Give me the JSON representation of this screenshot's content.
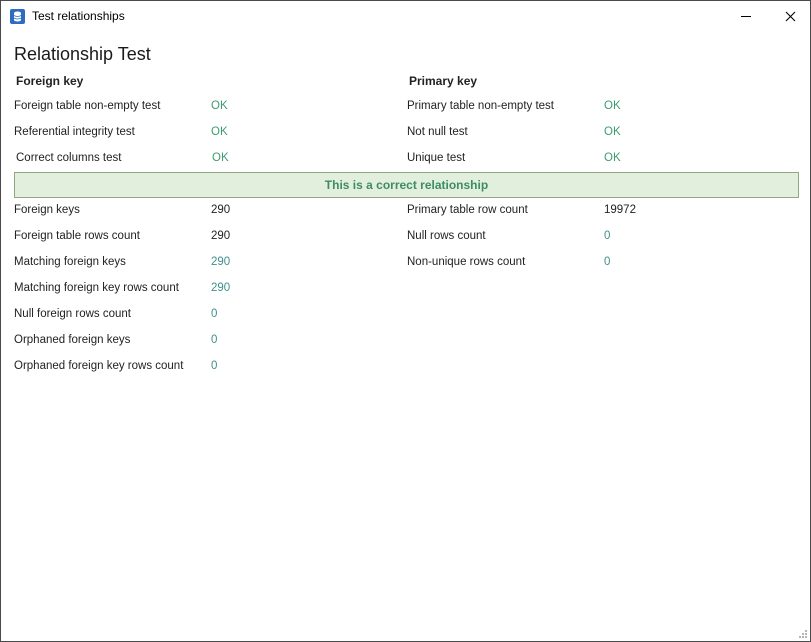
{
  "window": {
    "title": "Test relationships"
  },
  "heading": "Relationship Test",
  "foreign_key": {
    "title": "Foreign key",
    "tests": [
      {
        "label": "Foreign table non-empty test",
        "value": "OK"
      },
      {
        "label": "Referential integrity test",
        "value": "OK"
      },
      {
        "label": "Correct columns test",
        "value": "OK"
      }
    ],
    "stats": [
      {
        "label": "Foreign keys",
        "value": "290"
      },
      {
        "label": "Foreign table rows count",
        "value": "290"
      },
      {
        "label": "Matching foreign keys",
        "value": "290"
      },
      {
        "label": "Matching foreign key rows count",
        "value": "290"
      },
      {
        "label": "Null foreign rows count",
        "value": "0"
      },
      {
        "label": "Orphaned foreign keys",
        "value": "0"
      },
      {
        "label": "Orphaned foreign key rows count",
        "value": "0"
      }
    ]
  },
  "primary_key": {
    "title": "Primary key",
    "tests": [
      {
        "label": "Primary table non-empty test",
        "value": "OK"
      },
      {
        "label": "Not null test",
        "value": "OK"
      },
      {
        "label": "Unique test",
        "value": "OK"
      }
    ],
    "stats": [
      {
        "label": "Primary table row count",
        "value": "19972"
      },
      {
        "label": "Null rows count",
        "value": "0"
      },
      {
        "label": "Non-unique rows count",
        "value": "0"
      }
    ]
  },
  "result_banner": "This is a correct relationship",
  "colors": {
    "ok": "#3c9b73",
    "value_green": "#3f8f8a",
    "banner_bg": "#e2efdc",
    "banner_border": "#8fa883"
  }
}
